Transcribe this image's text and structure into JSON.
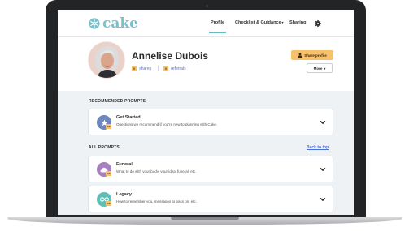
{
  "brand": {
    "name": "cake",
    "color": "#78c2cd",
    "accent": "#f6c16a"
  },
  "nav": {
    "items": [
      {
        "label": "Profile",
        "active": true
      },
      {
        "label": "Checklist & Guidance",
        "has_dropdown": true
      },
      {
        "label": "Sharing"
      }
    ],
    "dropdown_caret": "▾",
    "settings_icon": "gear-icon"
  },
  "profile": {
    "name": "Annelise Dubois",
    "shares": {
      "count": "0",
      "label": "shares"
    },
    "referrals": {
      "count": "0",
      "label": "referrals"
    },
    "share_button": "Share profile",
    "more_button": "More",
    "more_caret": "▾"
  },
  "recommended": {
    "title": "RECOMMENDED PROMPTS",
    "items": [
      {
        "title": "Get Started",
        "description": "Questions we recommend if you're new to planning with Cake.",
        "icon": "star-icon",
        "icon_color": "#6d86bf",
        "badge": "0/8"
      }
    ]
  },
  "all_prompts": {
    "title": "ALL PROMPTS",
    "back_to_top": "Back to top",
    "items": [
      {
        "title": "Funeral",
        "description": "What to do with your body, your ideal funeral, etc.",
        "icon": "cloud-icon",
        "icon_color": "#a77fbf",
        "badge": "0/8"
      },
      {
        "title": "Legacy",
        "description": "How to remember you, messages to pass on, etc.",
        "icon": "infinity-icon",
        "icon_color": "#5fbfb5",
        "badge": "0/8"
      }
    ]
  }
}
